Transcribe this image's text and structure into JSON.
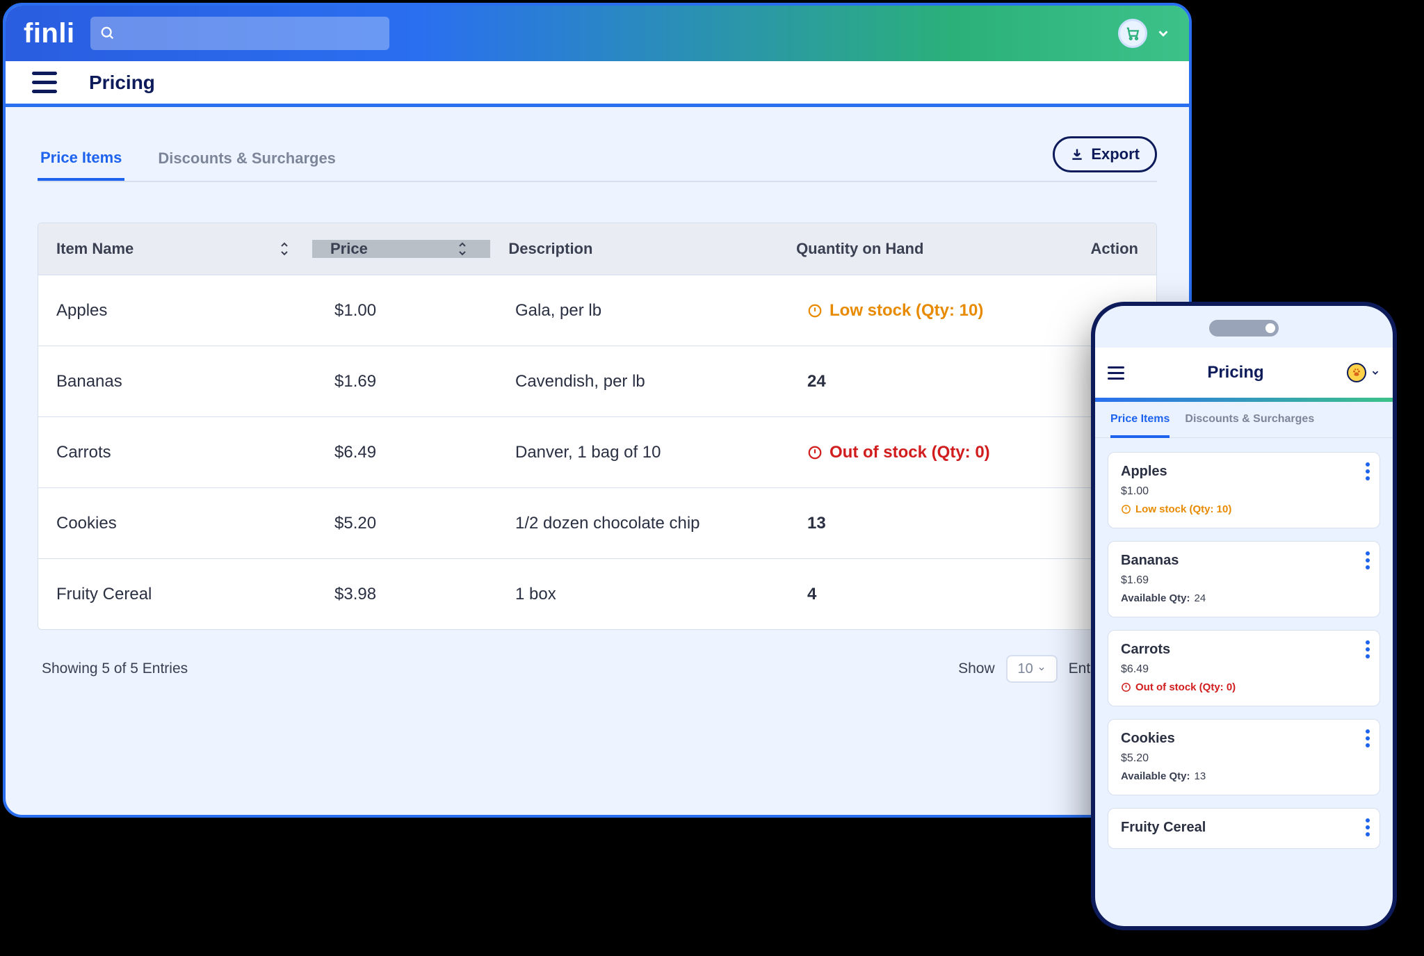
{
  "brand": "finli",
  "page_title": "Pricing",
  "search_placeholder": "",
  "tabs": {
    "price_items": "Price Items",
    "discounts": "Discounts & Surcharges"
  },
  "export_label": "Export",
  "columns": {
    "item": "Item Name",
    "price": "Price",
    "desc": "Description",
    "qty": "Quantity on Hand",
    "action": "Action"
  },
  "rows": [
    {
      "name": "Apples",
      "price": "$1.00",
      "desc": "Gala, per lb",
      "qty_text": "Low stock (Qty: 10)",
      "status": "low"
    },
    {
      "name": "Bananas",
      "price": "$1.69",
      "desc": "Cavendish, per lb",
      "qty_text": "24",
      "status": "ok"
    },
    {
      "name": "Carrots",
      "price": "$6.49",
      "desc": "Danver, 1 bag of 10",
      "qty_text": "Out of stock (Qty: 0)",
      "status": "out"
    },
    {
      "name": "Cookies",
      "price": "$5.20",
      "desc": "1/2 dozen chocolate chip",
      "qty_text": "13",
      "status": "ok"
    },
    {
      "name": "Fruity Cereal",
      "price": "$3.98",
      "desc": "1 box",
      "qty_text": "4",
      "status": "ok"
    }
  ],
  "footer": {
    "summary": "Showing 5 of 5 Entries",
    "show_label": "Show",
    "entries_label": "Entries",
    "page_size": "10"
  },
  "mobile": {
    "title": "Pricing",
    "tabs": {
      "price_items": "Price Items",
      "discounts": "Discounts & Surcharges"
    },
    "available_prefix": "Available Qty: ",
    "cards": [
      {
        "name": "Apples",
        "price": "$1.00",
        "line": "Low stock (Qty: 10)",
        "status": "low",
        "qty": ""
      },
      {
        "name": "Bananas",
        "price": "$1.69",
        "line": "",
        "status": "ok",
        "qty": "24"
      },
      {
        "name": "Carrots",
        "price": "$6.49",
        "line": "Out of stock (Qty: 0)",
        "status": "out",
        "qty": ""
      },
      {
        "name": "Cookies",
        "price": "$5.20",
        "line": "",
        "status": "ok",
        "qty": "13"
      },
      {
        "name": "Fruity Cereal",
        "price": "",
        "line": "",
        "status": "ok",
        "qty": ""
      }
    ]
  }
}
